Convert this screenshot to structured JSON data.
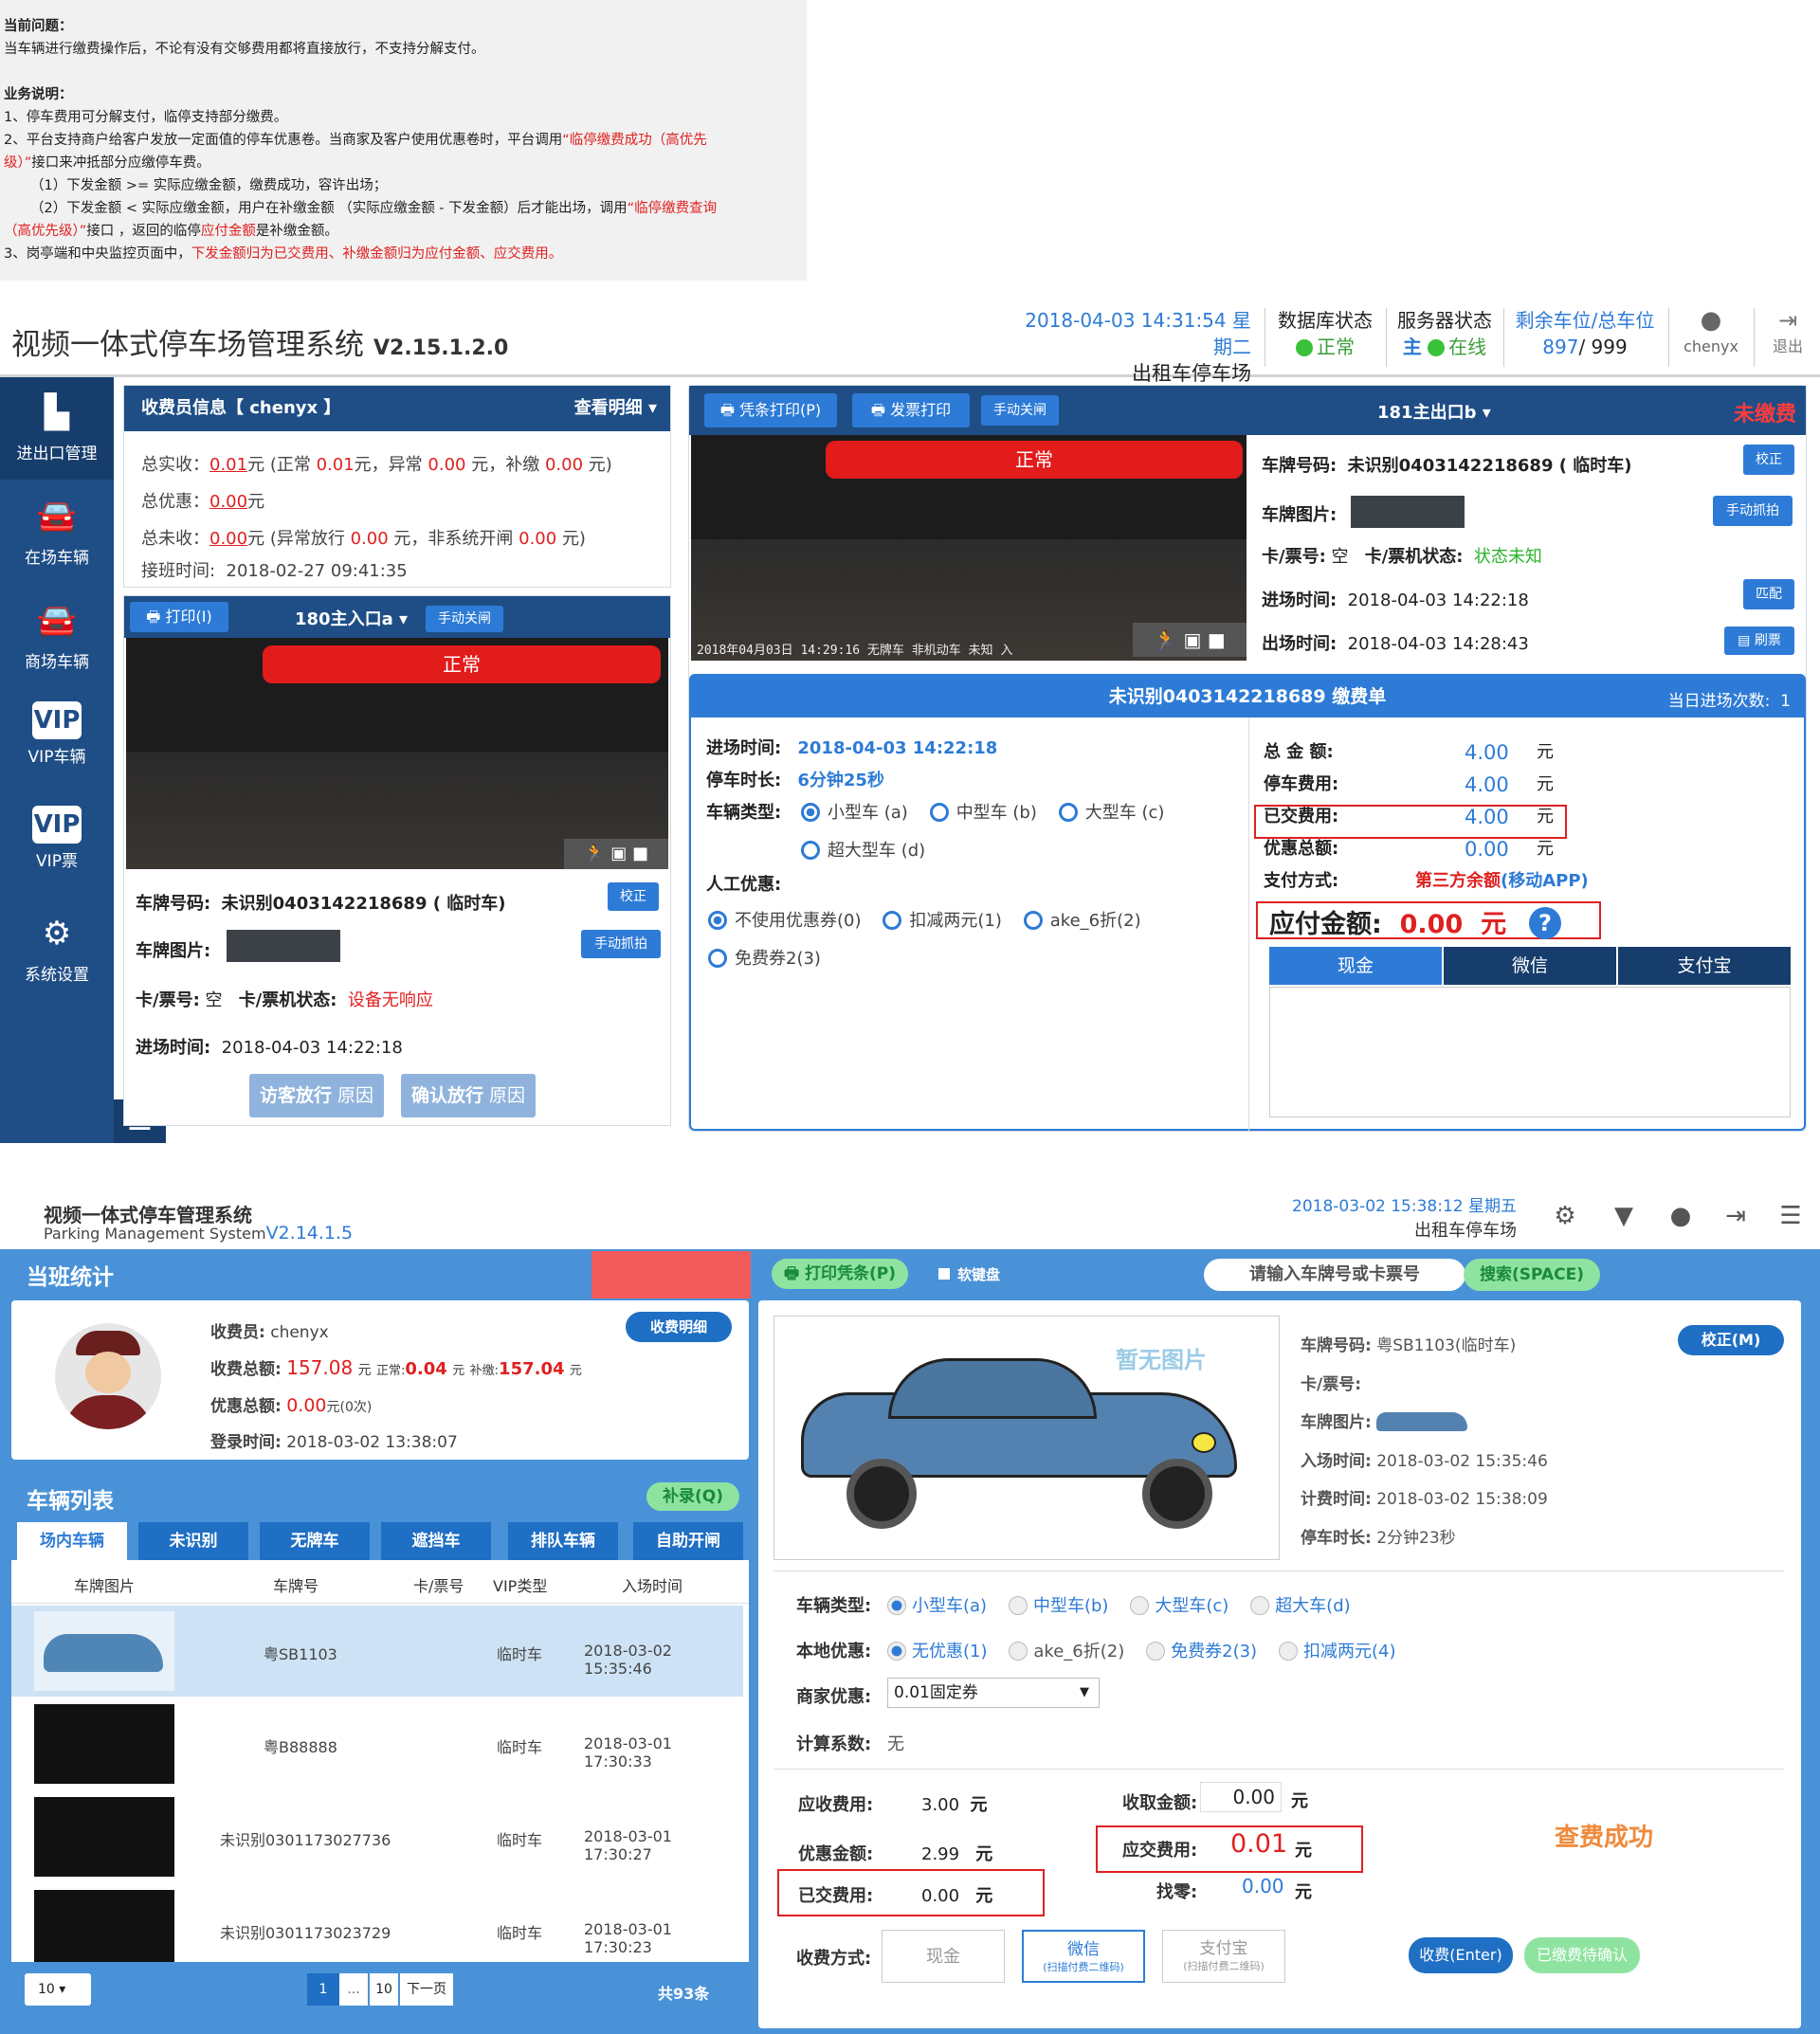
{
  "note": {
    "h1": "当前问题：",
    "l1": "当车辆进行缴费操作后，不论有没有交够费用都将直接放行，不支持分解支付。",
    "h2": "业务说明：",
    "l2": "1、停车费用可分解支付，临停支持部分缴费。",
    "l3a": "2、平台支持商户给客户发放一定面值的停车优惠卷。当商家及客户使用优惠卷时，平台调用",
    "l3b": "“临停缴费成功（高优先",
    "l4a": "级）”",
    "l4b": "接口来冲抵部分应缴停车费。",
    "l5": "（1）下发金额 >= 实际应缴金额，缴费成功，容许出场；",
    "l6a": "（2）下发金额 < 实际应缴金额，用户在补缴金额 （实际应缴金额 - 下发金额）后才能出场，调用",
    "l6b": "“临停缴费查询",
    "l7a": "（高优先级）”",
    "l7b": "接口 ，返回的临停",
    "l7c": "应付金额",
    "l7d": "是补缴金额。",
    "l8a": "3、岗亭端和中央监控页面中，",
    "l8b": "下发金额归为已交费用、补缴金额归为应付金额、应交费用。"
  },
  "s1": {
    "title": "视频一体式停车场管理系统",
    "version": "V2.15.1.2.0",
    "datetime": "2018-04-03 14:31:54 星期二",
    "lot": "出租车停车场",
    "db_label": "数据库状态",
    "db_status": "正常",
    "srv_label": "服务器状态",
    "srv_main": "主",
    "srv_status": "在线",
    "space_label": "剩余车位/总车位",
    "space_free": "897",
    "space_total": "/ 999",
    "user": "chenyx",
    "logout": "退出",
    "nav": [
      "进出口管理",
      "在场车辆",
      "商场车辆",
      "VIP车辆",
      "VIP票",
      "系统设置"
    ],
    "cashier_head": "收费员信息【 chenyx 】",
    "detail": "查看明细",
    "total_in_l": "总实收：",
    "total_in": "0.01",
    "yuan": "元",
    "total_in_p1": "(正常",
    "total_in_v1": "0.01",
    "total_in_p2": "元，异常",
    "total_in_v2": "0.00",
    "total_in_p3": "元，补缴",
    "total_in_v3": "0.00",
    "total_in_p4": "元)",
    "disc_l": "总优惠：",
    "disc": "0.00",
    "unpaid_l": "总未收：",
    "unpaid": "0.00",
    "unpaid_p1": "(异常放行",
    "unpaid_v1": "0.00",
    "unpaid_p2": "元，非系统开闸",
    "unpaid_v2": "0.00",
    "unpaid_p3": "元)",
    "shift_l": "接班时间:",
    "shift": "2018-02-27 09:41:35",
    "in_print": "打印(I)",
    "in_gate": "180主入口a",
    "manual_close": "手动关闸",
    "normal": "正常",
    "plate_l": "车牌号码:",
    "plate": "未识别0403142218689 ( 临时车)",
    "calib": "校正",
    "pimg_l": "车牌图片:",
    "manual_cap": "手动抓拍",
    "card_l": "卡/票号:",
    "card": "空",
    "cardm_l": "卡/票机状态:",
    "cardm_in": "设备无响应",
    "intime_l": "进场时间:",
    "intime": "2018-04-03 14:22:18",
    "visit": "访客放行",
    "reason": "原因",
    "confirm": "确认放行",
    "receipt": "凭条打印(P)",
    "invoice": "发票打印",
    "out_gate": "181主出口b",
    "unpaid_tag": "未缴费",
    "cam_ts": "2018年04月03日  14:29:16  无牌车  非机动车  未知  入",
    "cardm_out": "状态未知",
    "match": "匹配",
    "refresh": "刷票",
    "outtime_l": "出场时间:",
    "outtime": "2018-04-03 14:28:43",
    "bill_title": "未识别0403142218689  缴费单",
    "today_l": "当日进场次数:",
    "today": "1",
    "dur_l": "停车时长:",
    "dur": "6分钟25秒",
    "vtype_l": "车辆类型:",
    "vt": [
      "小型车 (a)",
      "中型车 (b)",
      "大型车 (c)",
      "超大型车 (d)"
    ],
    "manual_l": "人工优惠:",
    "md": [
      "不使用优惠券(0)",
      "扣减两元(1)",
      "ake_6折(2)",
      "免费券2(3)"
    ],
    "sum_l": "总 金 额:",
    "sum": "4.00",
    "fee_l": "停车费用:",
    "fee": "4.00",
    "paid_l": "已交费用:",
    "paid": "4.00",
    "dsum_l": "优惠总额:",
    "dsum": "0.00",
    "pay_l": "支付方式:",
    "pay_a": "第三方余额",
    "pay_b": "(移动APP)",
    "due_l": "应付金额:",
    "due": "0.00",
    "due_u": "元",
    "ptabs": [
      "现金",
      "微信",
      "支付宝"
    ]
  },
  "s2": {
    "title": "视频一体式停车管理系统",
    "sub": "Parking Management System",
    "version": "V2.14.1.5",
    "datetime": "2018-03-02 15:38:12 星期五",
    "lot": "出租车停车场",
    "shift_head": "当班统计",
    "cashier_l": "收费员:",
    "cashier": "chenyx",
    "detail": "收费明细",
    "total_l": "收费总额:",
    "total": "157.08",
    "yuan": "元",
    "normal_l": "正常:",
    "normal": "0.04",
    "supp_l": "补缴:",
    "supp": "157.04",
    "disc_l": "优惠总额:",
    "disc": "0.00",
    "disc_c": "元(0次)",
    "login_l": "登录时间:",
    "login": "2018-03-02 13:38:07",
    "vlist": "车辆列表",
    "supp_btn": "补录(Q)",
    "tabs": [
      "场内车辆",
      "未识别",
      "无牌车",
      "遮挡车",
      "排队车辆",
      "自助开闸"
    ],
    "cols": [
      "车牌图片",
      "车牌号",
      "卡/票号",
      "VIP类型",
      "入场时间"
    ],
    "rows": [
      [
        "粤SB1103",
        "临时车",
        "2018-03-02 15:35:46"
      ],
      [
        "粤B88888",
        "临时车",
        "2018-03-01 17:30:33"
      ],
      [
        "未识别0301173027736",
        "临时车",
        "2018-03-01 17:30:27"
      ],
      [
        "未识别0301173023729",
        "临时车",
        "2018-03-01 17:30:23"
      ]
    ],
    "page_size": "10",
    "p1": "1",
    "pdots": "...",
    "p10": "10",
    "next": "下一页",
    "count": "共93条",
    "print": "打印凭条(P)",
    "kbd": "软键盘",
    "search_ph": "请输入车牌号或卡票号",
    "search": "搜索(SPACE)",
    "noimg": "暂无图片",
    "plate_l": "车牌号码:",
    "plate": "粤SB1103(临时车)",
    "calib": "校正(M)",
    "card_l": "卡/票号:",
    "pimg_l": "车牌图片:",
    "in_l": "入场时间:",
    "in": "2018-03-02 15:35:46",
    "calc_l": "计费时间:",
    "calc": "2018-03-02 15:38:09",
    "dur_l": "停车时长:",
    "dur": "2分钟23秒",
    "vtype_l": "车辆类型:",
    "vt": [
      "小型车(a)",
      "中型车(b)",
      "大型车(c)",
      "超大车(d)"
    ],
    "local_l": "本地优惠:",
    "ld": [
      "无优惠(1)",
      "ake_6折(2)",
      "免费券2(3)",
      "扣减两元(4)"
    ],
    "merchant_l": "商家优惠:",
    "merchant": "0.01固定券",
    "coef_l": "计算系数:",
    "coef": "无",
    "recv_l": "应收费用:",
    "recv": "3.00",
    "yu": "元",
    "dsc_l": "优惠金额:",
    "dsc": "2.99",
    "paid_l": "已交费用:",
    "paid": "0.00",
    "take_l": "收取金额:",
    "take": "0.00",
    "due_l": "应交费用:",
    "due": "0.01",
    "change_l": "找零:",
    "change": "0.00",
    "ok": "查费成功",
    "pay_l": "收费方式:",
    "cash": "现金",
    "wx": "微信",
    "wx_s": "(扫描付费二维码)",
    "ali": "支付宝",
    "ali_s": "(扫描付费二维码)",
    "charge": "收费(Enter)",
    "confirm": "已缴费待确认"
  }
}
